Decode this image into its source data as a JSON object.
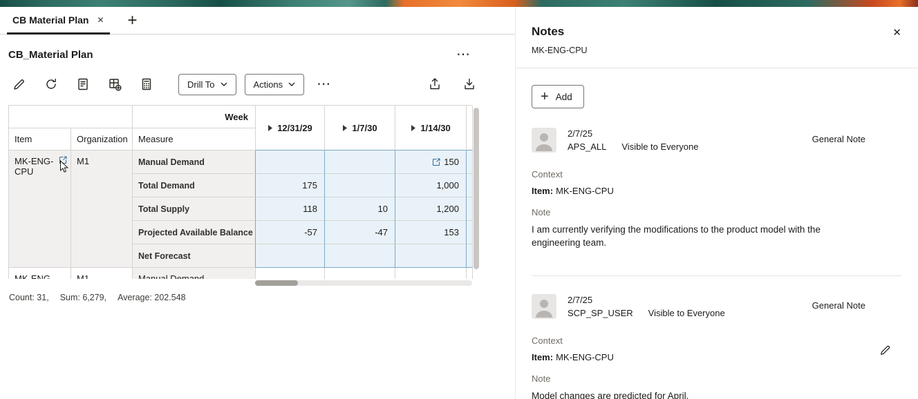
{
  "icons": {
    "close": "✕",
    "overflow": "⋯",
    "plus": "+"
  },
  "tabs": {
    "active": {
      "label": "CB Material Plan"
    }
  },
  "page": {
    "title": "CB_Material Plan"
  },
  "toolbar": {
    "drill_to_label": "Drill To",
    "actions_label": "Actions"
  },
  "table": {
    "week_label": "Week",
    "headers": {
      "item": "Item",
      "organization": "Organization",
      "measure": "Measure"
    },
    "columns": [
      "12/31/29",
      "1/7/30",
      "1/14/30"
    ],
    "group1": {
      "item": "MK-ENG-CPU",
      "organization": "M1",
      "rows": [
        {
          "measure": "Manual Demand",
          "values": [
            "",
            "",
            "150"
          ]
        },
        {
          "measure": "Total Demand",
          "values": [
            "175",
            "",
            "1,000"
          ]
        },
        {
          "measure": "Total Supply",
          "values": [
            "118",
            "10",
            "1,200"
          ]
        },
        {
          "measure": "Projected Available Balance",
          "values": [
            "-57",
            "-47",
            "153"
          ]
        },
        {
          "measure": "Net Forecast",
          "values": [
            "",
            "",
            ""
          ]
        }
      ]
    },
    "group2": {
      "item": "MK-ENG-CPU",
      "organization": "M1",
      "first_measure": "Manual Demand"
    },
    "summary": {
      "count": "Count: 31,",
      "sum": "Sum: 6,279,",
      "average": "Average: 202.548"
    }
  },
  "notes": {
    "title": "Notes",
    "subtitle": "MK-ENG-CPU",
    "add_label": "Add",
    "items": [
      {
        "date": "2/7/25",
        "author": "APS_ALL",
        "visibility": "Visible to Everyone",
        "type": "General Note",
        "context_label": "Context",
        "item_key": "Item:",
        "item_value": "MK-ENG-CPU",
        "note_label": "Note",
        "body": "I am currently verifying the modifications to the product model with the engineering team."
      },
      {
        "date": "2/7/25",
        "author": "SCP_SP_USER",
        "visibility": "Visible to Everyone",
        "type": "General Note",
        "context_label": "Context",
        "item_key": "Item:",
        "item_value": "MK-ENG-CPU",
        "note_label": "Note",
        "body": "Model changes are predicted for April."
      }
    ]
  }
}
